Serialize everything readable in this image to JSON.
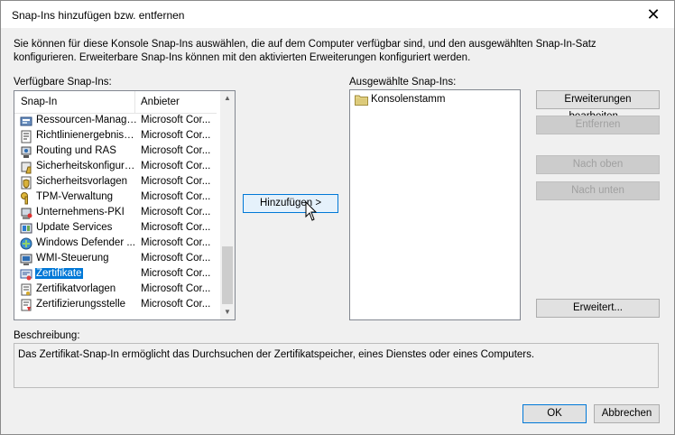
{
  "window": {
    "title": "Snap-Ins hinzufügen bzw. entfernen"
  },
  "intro": "Sie können für diese Konsole Snap-Ins auswählen, die auf dem Computer verfügbar sind, und den ausgewählten Snap-In-Satz konfigurieren. Erweiterbare Snap-Ins können mit den aktivierten Erweiterungen konfiguriert werden.",
  "available": {
    "label": "Verfügbare Snap-Ins:",
    "col_snapin": "Snap-In",
    "col_vendor": "Anbieter",
    "items": [
      {
        "name": "Ressourcen-Manage...",
        "vendor": "Microsoft Cor...",
        "icon": "resource-manager-icon"
      },
      {
        "name": "Richtlinienergebnissatz",
        "vendor": "Microsoft Cor...",
        "icon": "policy-result-icon"
      },
      {
        "name": "Routing und RAS",
        "vendor": "Microsoft Cor...",
        "icon": "routing-icon"
      },
      {
        "name": "Sicherheitskonfigura...",
        "vendor": "Microsoft Cor...",
        "icon": "security-config-icon"
      },
      {
        "name": "Sicherheitsvorlagen",
        "vendor": "Microsoft Cor...",
        "icon": "security-template-icon"
      },
      {
        "name": "TPM-Verwaltung",
        "vendor": "Microsoft Cor...",
        "icon": "tpm-key-icon"
      },
      {
        "name": "Unternehmens-PKI",
        "vendor": "Microsoft Cor...",
        "icon": "enterprise-pki-icon"
      },
      {
        "name": "Update Services",
        "vendor": "Microsoft Cor...",
        "icon": "update-services-icon"
      },
      {
        "name": "Windows Defender ...",
        "vendor": "Microsoft Cor...",
        "icon": "defender-firewall-icon"
      },
      {
        "name": "WMI-Steuerung",
        "vendor": "Microsoft Cor...",
        "icon": "wmi-icon"
      },
      {
        "name": "Zertifikate",
        "vendor": "Microsoft Cor...",
        "icon": "certificate-icon",
        "selected": true
      },
      {
        "name": "Zertifikatvorlagen",
        "vendor": "Microsoft Cor...",
        "icon": "certificate-template-icon"
      },
      {
        "name": "Zertifizierungsstelle",
        "vendor": "Microsoft Cor...",
        "icon": "certification-authority-icon"
      }
    ]
  },
  "add_button": "Hinzufügen >",
  "selected": {
    "label": "Ausgewählte Snap-Ins:",
    "root": "Konsolenstamm"
  },
  "side_buttons": {
    "edit_extensions": "Erweiterungen bearbeiten...",
    "remove": "Entfernen",
    "move_up": "Nach oben",
    "move_down": "Nach unten",
    "advanced": "Erweitert..."
  },
  "description": {
    "label": "Beschreibung:",
    "text": "Das Zertifikat-Snap-In ermöglicht das Durchsuchen der Zertifikatspeicher, eines Dienstes oder eines Computers."
  },
  "footer": {
    "ok": "OK",
    "cancel": "Abbrechen"
  },
  "colors": {
    "selection": "#0078d7",
    "dialog_bg": "#f0f0f0",
    "folder": "#d8c26a"
  }
}
